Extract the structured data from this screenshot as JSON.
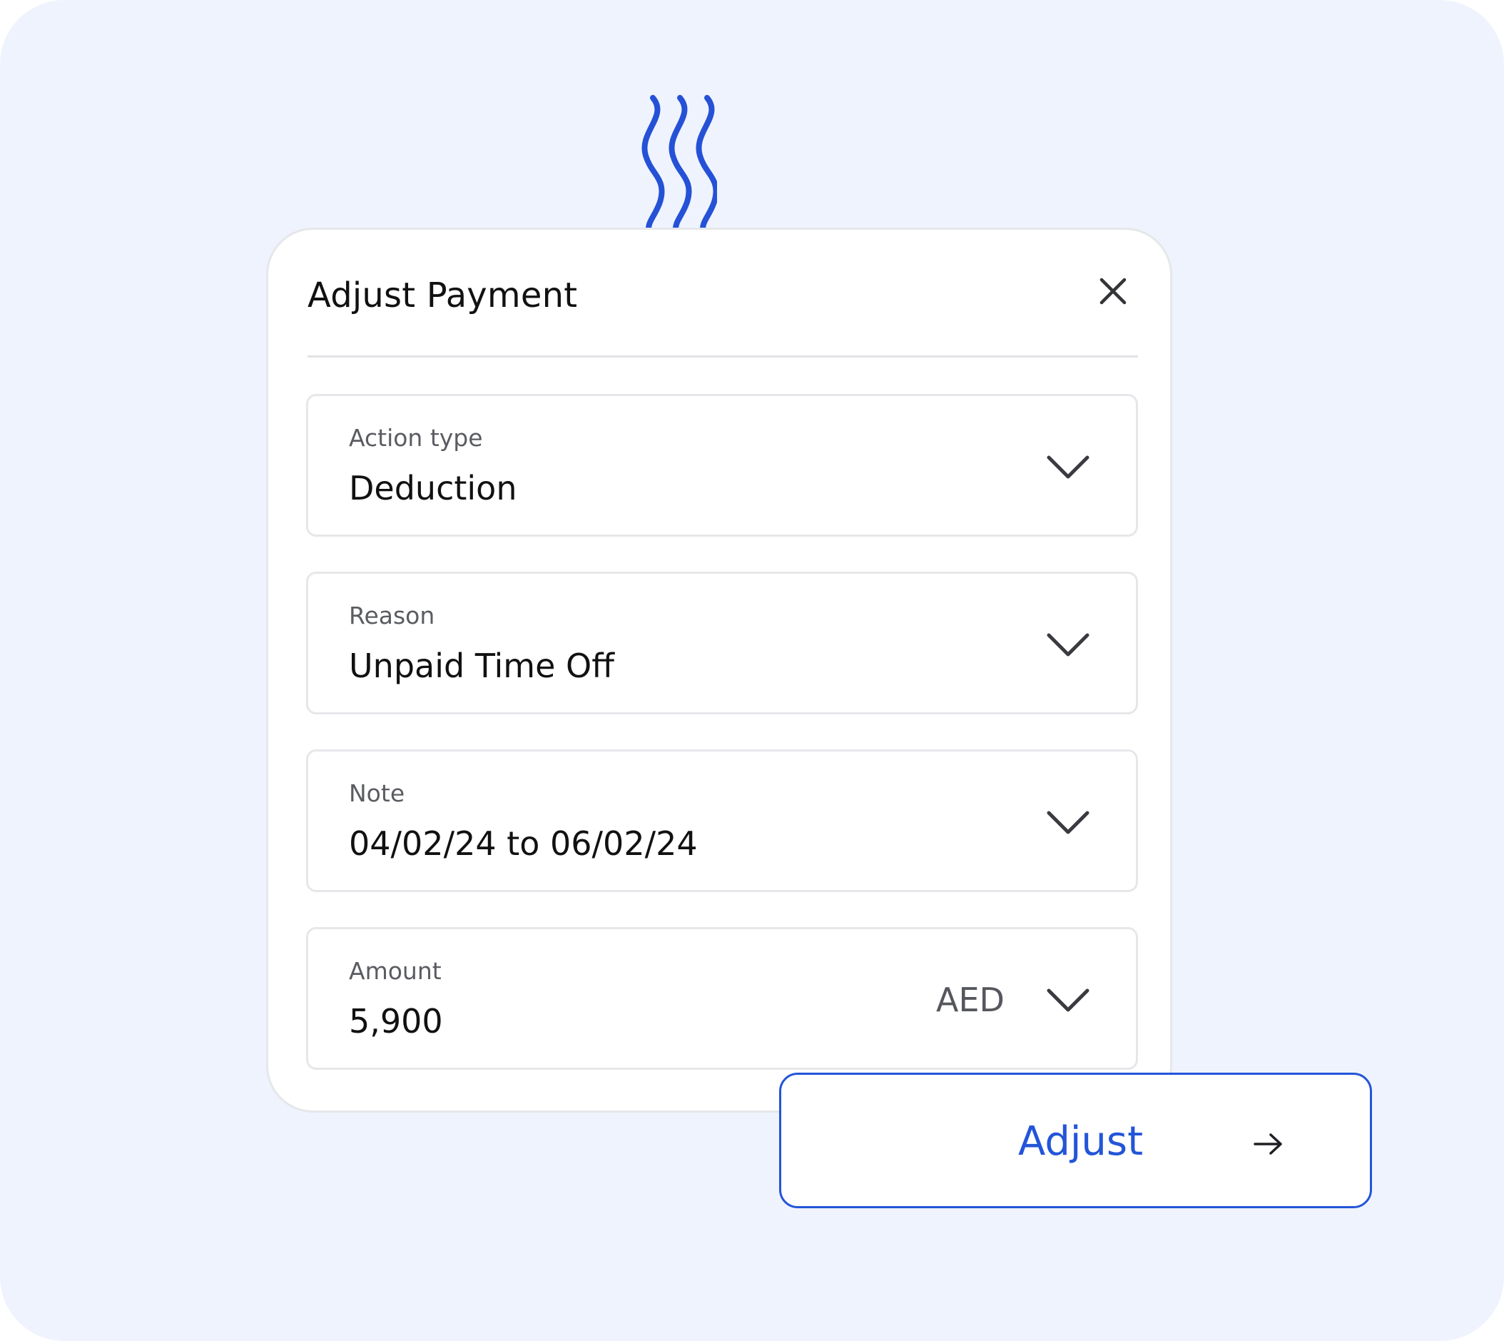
{
  "modal": {
    "title": "Adjust Payment",
    "close_icon": "close-icon"
  },
  "fields": [
    {
      "label": "Action type",
      "value": "Deduction",
      "icon": "chevron-down-icon"
    },
    {
      "label": "Reason",
      "value": "Unpaid Time Off",
      "icon": "chevron-down-icon"
    },
    {
      "label": "Note",
      "value": "04/02/24 to 06/02/24",
      "icon": "chevron-down-icon"
    },
    {
      "label": "Amount",
      "value": "5,900",
      "currency": "AED",
      "icon": "chevron-down-icon"
    }
  ],
  "submit": {
    "label": "Adjust",
    "icon": "arrow-right-icon"
  },
  "decoration": {
    "icon": "steam-wave-icon"
  },
  "colors": {
    "background": "#eff3fd",
    "accent": "#2355d8",
    "text": "#111111",
    "muted_text": "#5a5c62",
    "border": "#e6e7ea"
  }
}
